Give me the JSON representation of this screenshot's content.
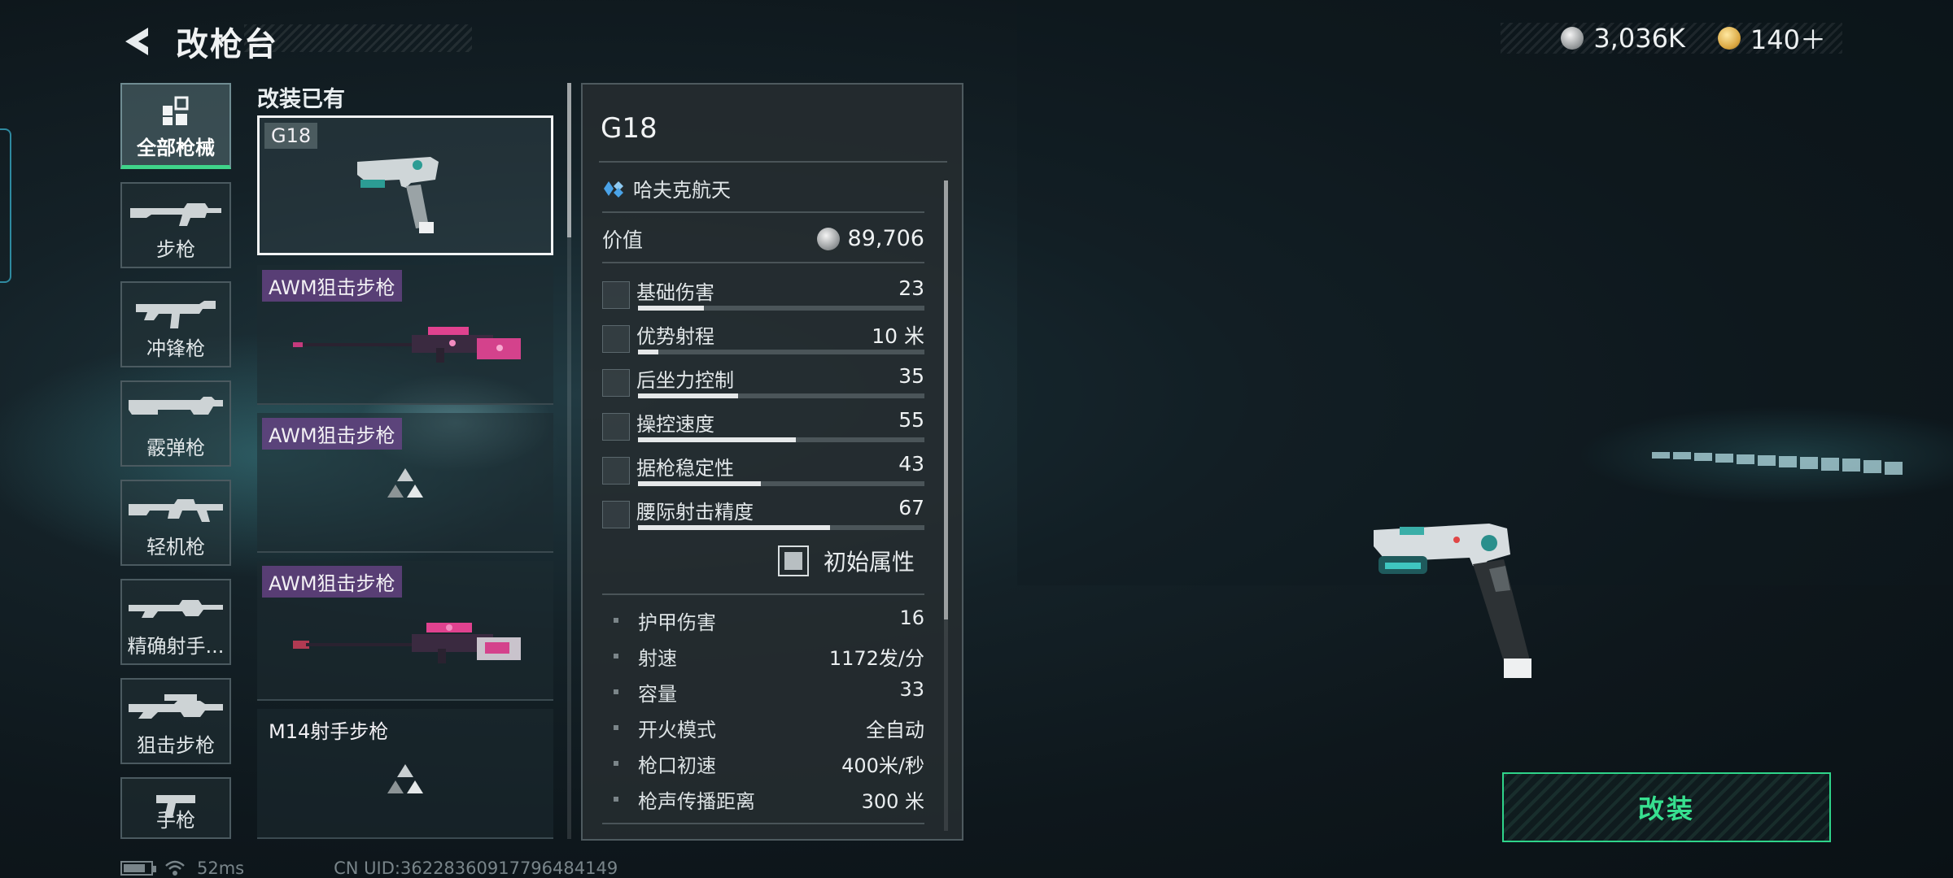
{
  "header": {
    "title": "改枪台",
    "currencies": [
      {
        "icon": "silver-coin-icon",
        "value": "3,036K"
      },
      {
        "icon": "gold-coin-icon",
        "value": "140＋"
      }
    ]
  },
  "categories": [
    {
      "label": "全部枪械",
      "icon": "grid-icon",
      "active": true
    },
    {
      "label": "步枪",
      "icon": "rifle-icon",
      "active": false
    },
    {
      "label": "冲锋枪",
      "icon": "smg-icon",
      "active": false
    },
    {
      "label": "霰弹枪",
      "icon": "shotgun-icon",
      "active": false
    },
    {
      "label": "轻机枪",
      "icon": "lmg-icon",
      "active": false
    },
    {
      "label": "精确射手...",
      "icon": "marksman-rifle-icon",
      "active": false
    },
    {
      "label": "狙击步枪",
      "icon": "sniper-rifle-icon",
      "active": false
    },
    {
      "label": "手枪",
      "icon": "pistol-icon",
      "active": false
    }
  ],
  "owned": {
    "title": "改装已有",
    "items": [
      {
        "name": "G18",
        "image": "pistol-thumbnail",
        "selected": true
      },
      {
        "name": "AWM狙击步枪",
        "image": "pink-sniper-thumbnail",
        "selected": false
      },
      {
        "name": "AWM狙击步枪",
        "image": "triangle-placeholder-icon",
        "selected": false
      },
      {
        "name": "AWM狙击步枪",
        "image": "pink-sniper-thumbnail",
        "selected": false
      },
      {
        "name": "M14射手步枪",
        "image": "triangle-placeholder-icon",
        "selected": false
      }
    ]
  },
  "detail": {
    "name": "G18",
    "manufacturer": "哈夫克航天",
    "value_label": "价值",
    "value": "89,706",
    "stats": [
      {
        "label": "基础伤害",
        "value": "23",
        "level": 0.23
      },
      {
        "label": "优势射程",
        "value": "10 米",
        "level": 0.07
      },
      {
        "label": "后坐力控制",
        "value": "35",
        "level": 0.35
      },
      {
        "label": "操控速度",
        "value": "55",
        "level": 0.55
      },
      {
        "label": "据枪稳定性",
        "value": "43",
        "level": 0.43
      },
      {
        "label": "腰际射击精度",
        "value": "67",
        "level": 0.67
      }
    ],
    "toggle_label": "初始属性",
    "specs": [
      {
        "label": "护甲伤害",
        "value": "16"
      },
      {
        "label": "射速",
        "value": "1172发/分"
      },
      {
        "label": "容量",
        "value": "33"
      },
      {
        "label": "开火模式",
        "value": "全自动"
      },
      {
        "label": "枪口初速",
        "value": "400米/秒"
      },
      {
        "label": "枪声传播距离",
        "value": "300 米"
      }
    ]
  },
  "actions": {
    "modify_label": "改装"
  },
  "status": {
    "ping": "52ms",
    "uid": "CN UID:36228360917796484149"
  },
  "colors": {
    "accent": "#37e08f",
    "tag_purple": "#6e468c",
    "highlight": "#f2f4f5"
  }
}
